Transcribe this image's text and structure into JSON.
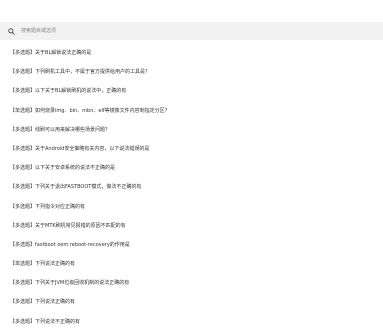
{
  "search": {
    "placeholder": "搜索题目或选项"
  },
  "questions": [
    {
      "type": "【多选题】",
      "text": "关于BL解锁说法正确的是"
    },
    {
      "type": "【多选题】",
      "text": "下列刷机工具中，不属于官方提供给用户的工具是？"
    },
    {
      "type": "【多选题】",
      "text": "以下关于BL解锁刷机的说法中，正确的有"
    },
    {
      "type": "【单选题】",
      "text": "如何烧录img、bin、mbn、elf等镜像文件内容到指定分区？"
    },
    {
      "type": "【多选题】",
      "text": "线刷可以用来解决哪些场景问题？"
    },
    {
      "type": "【多选题】",
      "text": "关于Android安全策略有关内容，以下说法错误的是"
    },
    {
      "type": "【多选题】",
      "text": "以下关于安卓系统的说法不正确的是"
    },
    {
      "type": "【多选题】",
      "text": "下列关于退出FASTBOOT模式，做法不正确的有"
    },
    {
      "type": "【多选题】",
      "text": "下列指令对应正确的有"
    },
    {
      "type": "【多选题】",
      "text": "关于MTK刷机常见报错的原因不匹配的有"
    },
    {
      "type": "【多选题】",
      "text": "fastboot oem reboot-recovery的作用是"
    },
    {
      "type": "【单选题】",
      "text": "下列说法正确的有"
    },
    {
      "type": "【多选题】",
      "text": "下列关于JVM垃圾回收机制的说法正确的有"
    },
    {
      "type": "【多选题】",
      "text": "下列说法正确的有"
    },
    {
      "type": "【多选题】",
      "text": "下列说法不正确的有"
    }
  ],
  "colors": {
    "search_bg": "#f2f2f2",
    "text": "#333333",
    "placeholder": "#8a8a8a"
  },
  "icons": {
    "search": "search-icon"
  }
}
